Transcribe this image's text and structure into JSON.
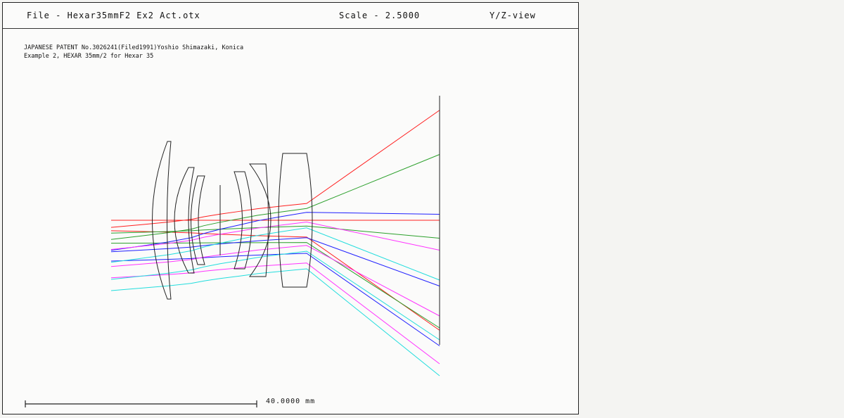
{
  "header": {
    "file": "File - Hexar35mmF2 Ex2 Act.otx",
    "scale": "Scale - 2.5000",
    "view": "Y/Z-view"
  },
  "notes": [
    "JAPANESE PATENT No.3026241(Filed1991)Yoshio Shimazaki, Konica",
    "Example 2, HEXAR 35mm/2 for Hexar 35"
  ],
  "scale_bar": {
    "length_label": "40.0000 mm"
  },
  "colors": {
    "lens": "#222222",
    "image_plane": "#222222",
    "field_1": "#ff2020",
    "field_2": "#2ca02c",
    "field_3": "#2020ff",
    "field_4": "#ff33ff",
    "field_5": "#22dddd"
  },
  "fields": [
    {
      "color_key": "field_1",
      "rays": [
        [
          0.92,
          0.18
        ],
        [
          0.0,
          0.0
        ],
        [
          -0.92,
          -0.18
        ]
      ]
    },
    {
      "color_key": "field_2",
      "rays": [
        [
          0.55,
          0.05
        ],
        [
          -0.15,
          -0.15
        ],
        [
          -0.9,
          -0.32
        ]
      ]
    },
    {
      "color_key": "field_3",
      "rays": [
        [
          0.05,
          -0.05
        ],
        [
          -0.55,
          -0.45
        ],
        [
          -1.05,
          -0.6
        ]
      ]
    },
    {
      "color_key": "field_4",
      "rays": [
        [
          -0.25,
          -0.3
        ],
        [
          -0.8,
          -0.65
        ],
        [
          -1.2,
          -0.85
        ]
      ]
    },
    {
      "color_key": "field_5",
      "rays": [
        [
          -0.5,
          -0.45
        ],
        [
          -1.0,
          -0.8
        ],
        [
          -1.3,
          -1.0
        ]
      ]
    }
  ]
}
